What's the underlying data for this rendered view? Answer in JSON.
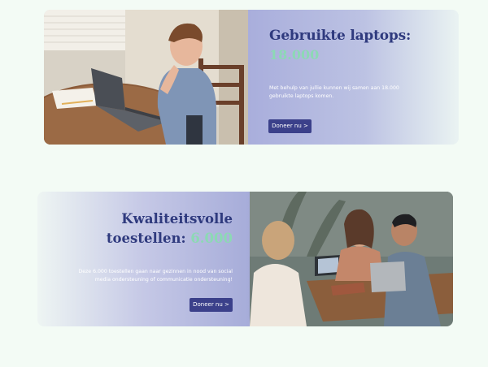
{
  "card1": {
    "title": "Gebruikte laptops:",
    "stat": "18.000",
    "description": "Met behulp van jullie kunnen wij samen aan 18.000 gebruikte laptops komen.",
    "button": "Doneer nu >",
    "image": "boy-with-laptop-photo"
  },
  "card2": {
    "title_line1": "Kwaliteitsvolle",
    "title_line2": "toestellen:",
    "stat": "6.000",
    "description": "Deze 6.000 toestellen gaan naar gezinnen in nood van social media ondersteuning of communicatie ondersteuning!",
    "button": "Doneer nu >",
    "image": "students-with-laptops-photo"
  },
  "colors": {
    "background": "#f3fbf5",
    "heading": "#2f3a7e",
    "accent": "#8cd9b4",
    "button": "#3b408a"
  }
}
